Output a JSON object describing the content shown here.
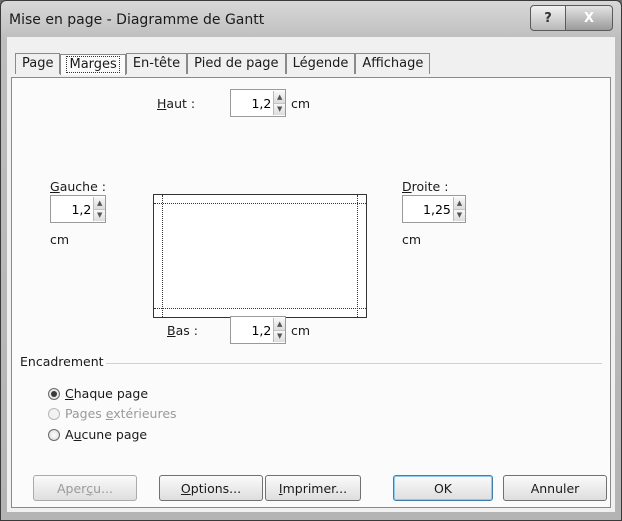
{
  "window": {
    "title": "Mise en page - Diagramme de Gantt",
    "help_label": "?",
    "close_label": "X"
  },
  "tabs": [
    {
      "label": "Page",
      "active": false
    },
    {
      "label": "Marges",
      "active": true
    },
    {
      "label": "En-tête",
      "active": false
    },
    {
      "label": "Pied de page",
      "active": false
    },
    {
      "label": "Légende",
      "active": false
    },
    {
      "label": "Affichage",
      "active": false
    }
  ],
  "margins": {
    "top": {
      "label_key": "H",
      "label_rest": "aut :",
      "value": "1,2",
      "unit": "cm"
    },
    "left": {
      "label_key": "G",
      "label_rest": "auche :",
      "value": "1,2",
      "unit": "cm"
    },
    "right": {
      "label_key": "D",
      "label_rest": "roite :",
      "value": "1,25",
      "unit": "cm"
    },
    "bottom": {
      "label_key": "B",
      "label_rest": "as :",
      "value": "1,2",
      "unit": "cm"
    }
  },
  "borders": {
    "group_label": "Encadrement",
    "options": [
      {
        "prefix": "",
        "key": "C",
        "suffix": "haque page",
        "checked": true,
        "disabled": false
      },
      {
        "prefix": "Pages ",
        "key": "e",
        "suffix": "xtérieures",
        "checked": false,
        "disabled": true
      },
      {
        "prefix": "A",
        "key": "u",
        "suffix": "cune page",
        "checked": false,
        "disabled": false
      }
    ]
  },
  "buttons": {
    "preview": {
      "prefix": "Aper",
      "key": "ç",
      "suffix": "u..."
    },
    "options": {
      "prefix": "",
      "key": "O",
      "suffix": "ptions..."
    },
    "print": {
      "prefix": "",
      "key": "I",
      "suffix": "mprimer..."
    },
    "ok": "OK",
    "cancel": "Annuler"
  }
}
